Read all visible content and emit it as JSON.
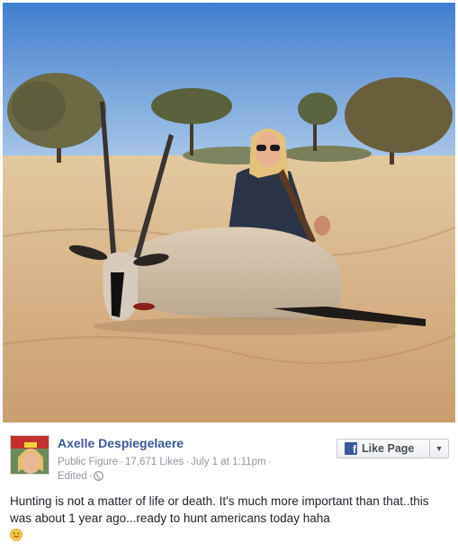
{
  "post": {
    "author": "Axelle Despiegelaere",
    "category": "Public Figure",
    "likes": "17,671 Likes",
    "timestamp": "July 1 at 1:11pm",
    "edited": "Edited",
    "audience_icon": "globe-icon",
    "text": "Hunting is not a matter of life or death. It's much more important than that..this was about 1 year ago...ready to hunt americans today haha",
    "emoji": "tongue-out-emoji"
  },
  "like_button": {
    "label": "Like Page",
    "icon": "facebook-f-icon",
    "dropdown_icon": "caret-down-icon"
  },
  "photo": {
    "subject": "hunting-photo",
    "sky_color": "#6a9fd8",
    "ground_color": "#d9b98a"
  },
  "colors": {
    "brand": "#3b5998",
    "meta_text": "#90949c"
  }
}
